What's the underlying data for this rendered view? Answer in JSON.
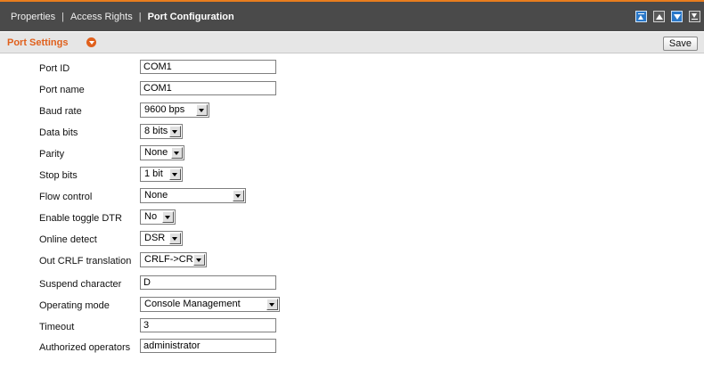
{
  "tabs": [
    {
      "label": "Properties",
      "active": false
    },
    {
      "label": "Access Rights",
      "active": false
    },
    {
      "label": "Port Configuration",
      "active": true
    }
  ],
  "tab_separator": "|",
  "window_icons": [
    "move-top-icon",
    "move-up-icon",
    "move-down-icon",
    "move-bottom-icon"
  ],
  "section": {
    "title": "Port Settings",
    "toggle_icon": "collapse-arrow-icon",
    "save_label": "Save"
  },
  "fields": [
    {
      "label": "Port ID",
      "type": "text",
      "value": "COM1"
    },
    {
      "label": "Port name",
      "type": "text",
      "value": "COM1"
    },
    {
      "label": "Baud rate",
      "type": "select",
      "value": "9600 bps"
    },
    {
      "label": "Data bits",
      "type": "select",
      "value": "8 bits"
    },
    {
      "label": "Parity",
      "type": "select",
      "value": "None"
    },
    {
      "label": "Stop bits",
      "type": "select",
      "value": "1 bit"
    },
    {
      "label": "Flow control",
      "type": "select",
      "value": "None"
    },
    {
      "label": "Enable toggle DTR",
      "type": "select",
      "value": "No"
    },
    {
      "label": "Online detect",
      "type": "select",
      "value": "DSR"
    },
    {
      "label": "Out CRLF translation",
      "type": "select",
      "value": "CRLF->CR"
    },
    {
      "label": "Suspend character",
      "type": "text",
      "value": "D"
    },
    {
      "label": "Operating mode",
      "type": "select",
      "value": "Console Management"
    },
    {
      "label": "Timeout",
      "type": "text",
      "value": "3"
    },
    {
      "label": "Authorized operators",
      "type": "text",
      "value": "administrator"
    }
  ],
  "colors": {
    "topbar_bg": "#4a4a4a",
    "accent_orange": "#e87d1e",
    "section_title": "#e0601c",
    "icon_blue": "#2a78c9"
  }
}
